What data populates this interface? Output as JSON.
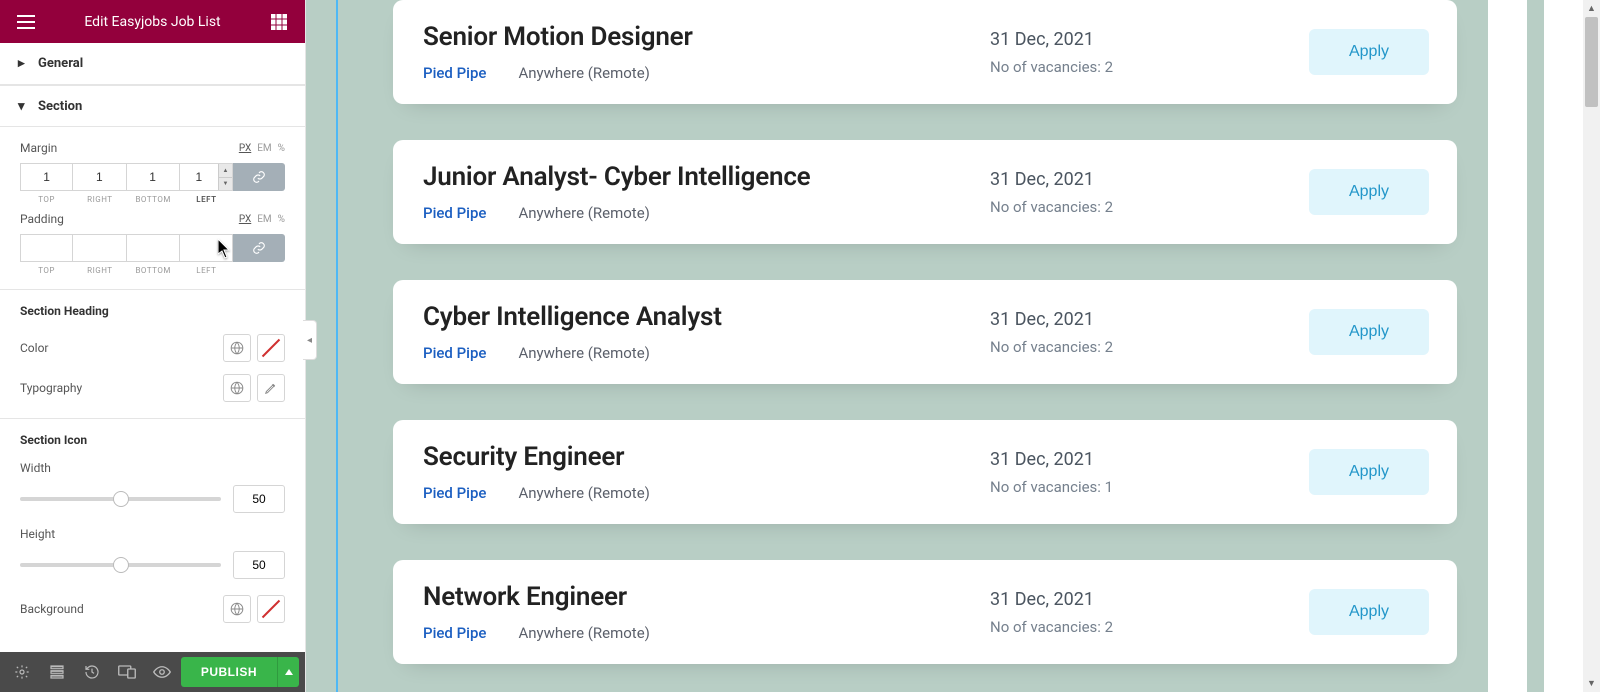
{
  "header": {
    "title": "Edit Easyjobs Job List"
  },
  "sections": {
    "general": {
      "label": "General",
      "open": false
    },
    "section": {
      "label": "Section",
      "open": true,
      "margin": {
        "label": "Margin",
        "units": [
          "PX",
          "EM",
          "%"
        ],
        "active_unit": "PX",
        "top": "1",
        "right": "1",
        "bottom": "1",
        "left": "1",
        "sub": {
          "top": "TOP",
          "right": "RIGHT",
          "bottom": "BOTTOM",
          "left": "LEFT"
        }
      },
      "padding": {
        "label": "Padding",
        "units": [
          "PX",
          "EM",
          "%"
        ],
        "active_unit": "PX",
        "top": "",
        "right": "",
        "bottom": "",
        "left": "",
        "sub": {
          "top": "TOP",
          "right": "RIGHT",
          "bottom": "BOTTOM",
          "left": "LEFT"
        }
      }
    },
    "heading": {
      "label": "Section Heading",
      "color_label": "Color",
      "typography_label": "Typography"
    },
    "icon": {
      "label": "Section Icon",
      "width_label": "Width",
      "width_value": "50",
      "height_label": "Height",
      "height_value": "50",
      "background_label": "Background"
    }
  },
  "footer": {
    "publish_label": "PUBLISH"
  },
  "jobs": [
    {
      "title": "Senior Motion Designer",
      "company": "Pied Pipe",
      "location": "Anywhere (Remote)",
      "date": "31 Dec, 2021",
      "vacancies": "No of vacancies: 2",
      "apply": "Apply"
    },
    {
      "title": "Junior Analyst- Cyber Intelligence",
      "company": "Pied Pipe",
      "location": "Anywhere (Remote)",
      "date": "31 Dec, 2021",
      "vacancies": "No of vacancies: 2",
      "apply": "Apply"
    },
    {
      "title": "Cyber Intelligence Analyst",
      "company": "Pied Pipe",
      "location": "Anywhere (Remote)",
      "date": "31 Dec, 2021",
      "vacancies": "No of vacancies: 2",
      "apply": "Apply"
    },
    {
      "title": "Security Engineer",
      "company": "Pied Pipe",
      "location": "Anywhere (Remote)",
      "date": "31 Dec, 2021",
      "vacancies": "No of vacancies: 1",
      "apply": "Apply"
    },
    {
      "title": "Network Engineer",
      "company": "Pied Pipe",
      "location": "Anywhere (Remote)",
      "date": "31 Dec, 2021",
      "vacancies": "No of vacancies: 2",
      "apply": "Apply"
    }
  ]
}
